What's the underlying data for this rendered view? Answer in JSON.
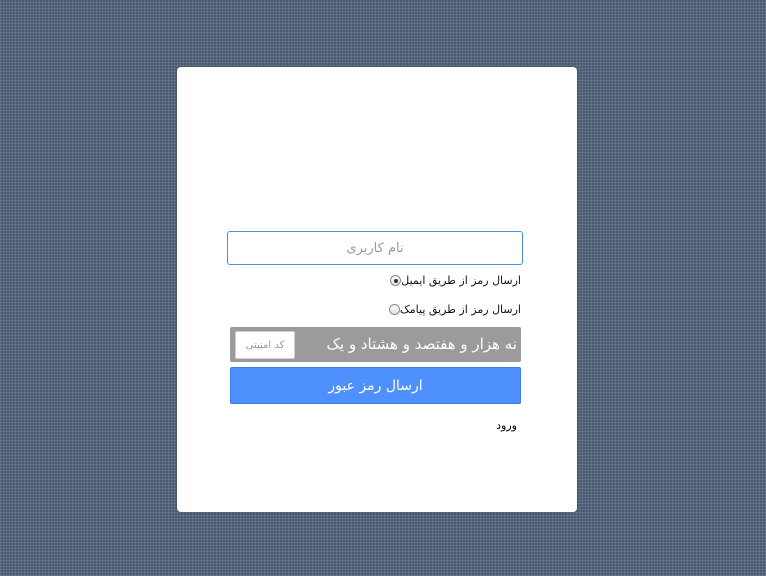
{
  "login_form": {
    "username_placeholder": "نام کاربری",
    "username_value": "",
    "options": [
      {
        "label": "ارسال رمز از طریق ایمیل",
        "checked": true
      },
      {
        "label": "ارسال رمز از طریق پیامک",
        "checked": false
      }
    ],
    "captcha": {
      "question": "نه هزار و هفتصد و هشتاد و یک",
      "input_placeholder": "کد امنیتی"
    },
    "submit_label": "ارسال رمز عبور",
    "login_link": "ورود"
  },
  "colors": {
    "background": "#4a5a72",
    "card": "#ffffff",
    "primary_button": "#4d90fe",
    "captcha_bg": "#9b9b9b",
    "input_border": "#4a90e2"
  }
}
